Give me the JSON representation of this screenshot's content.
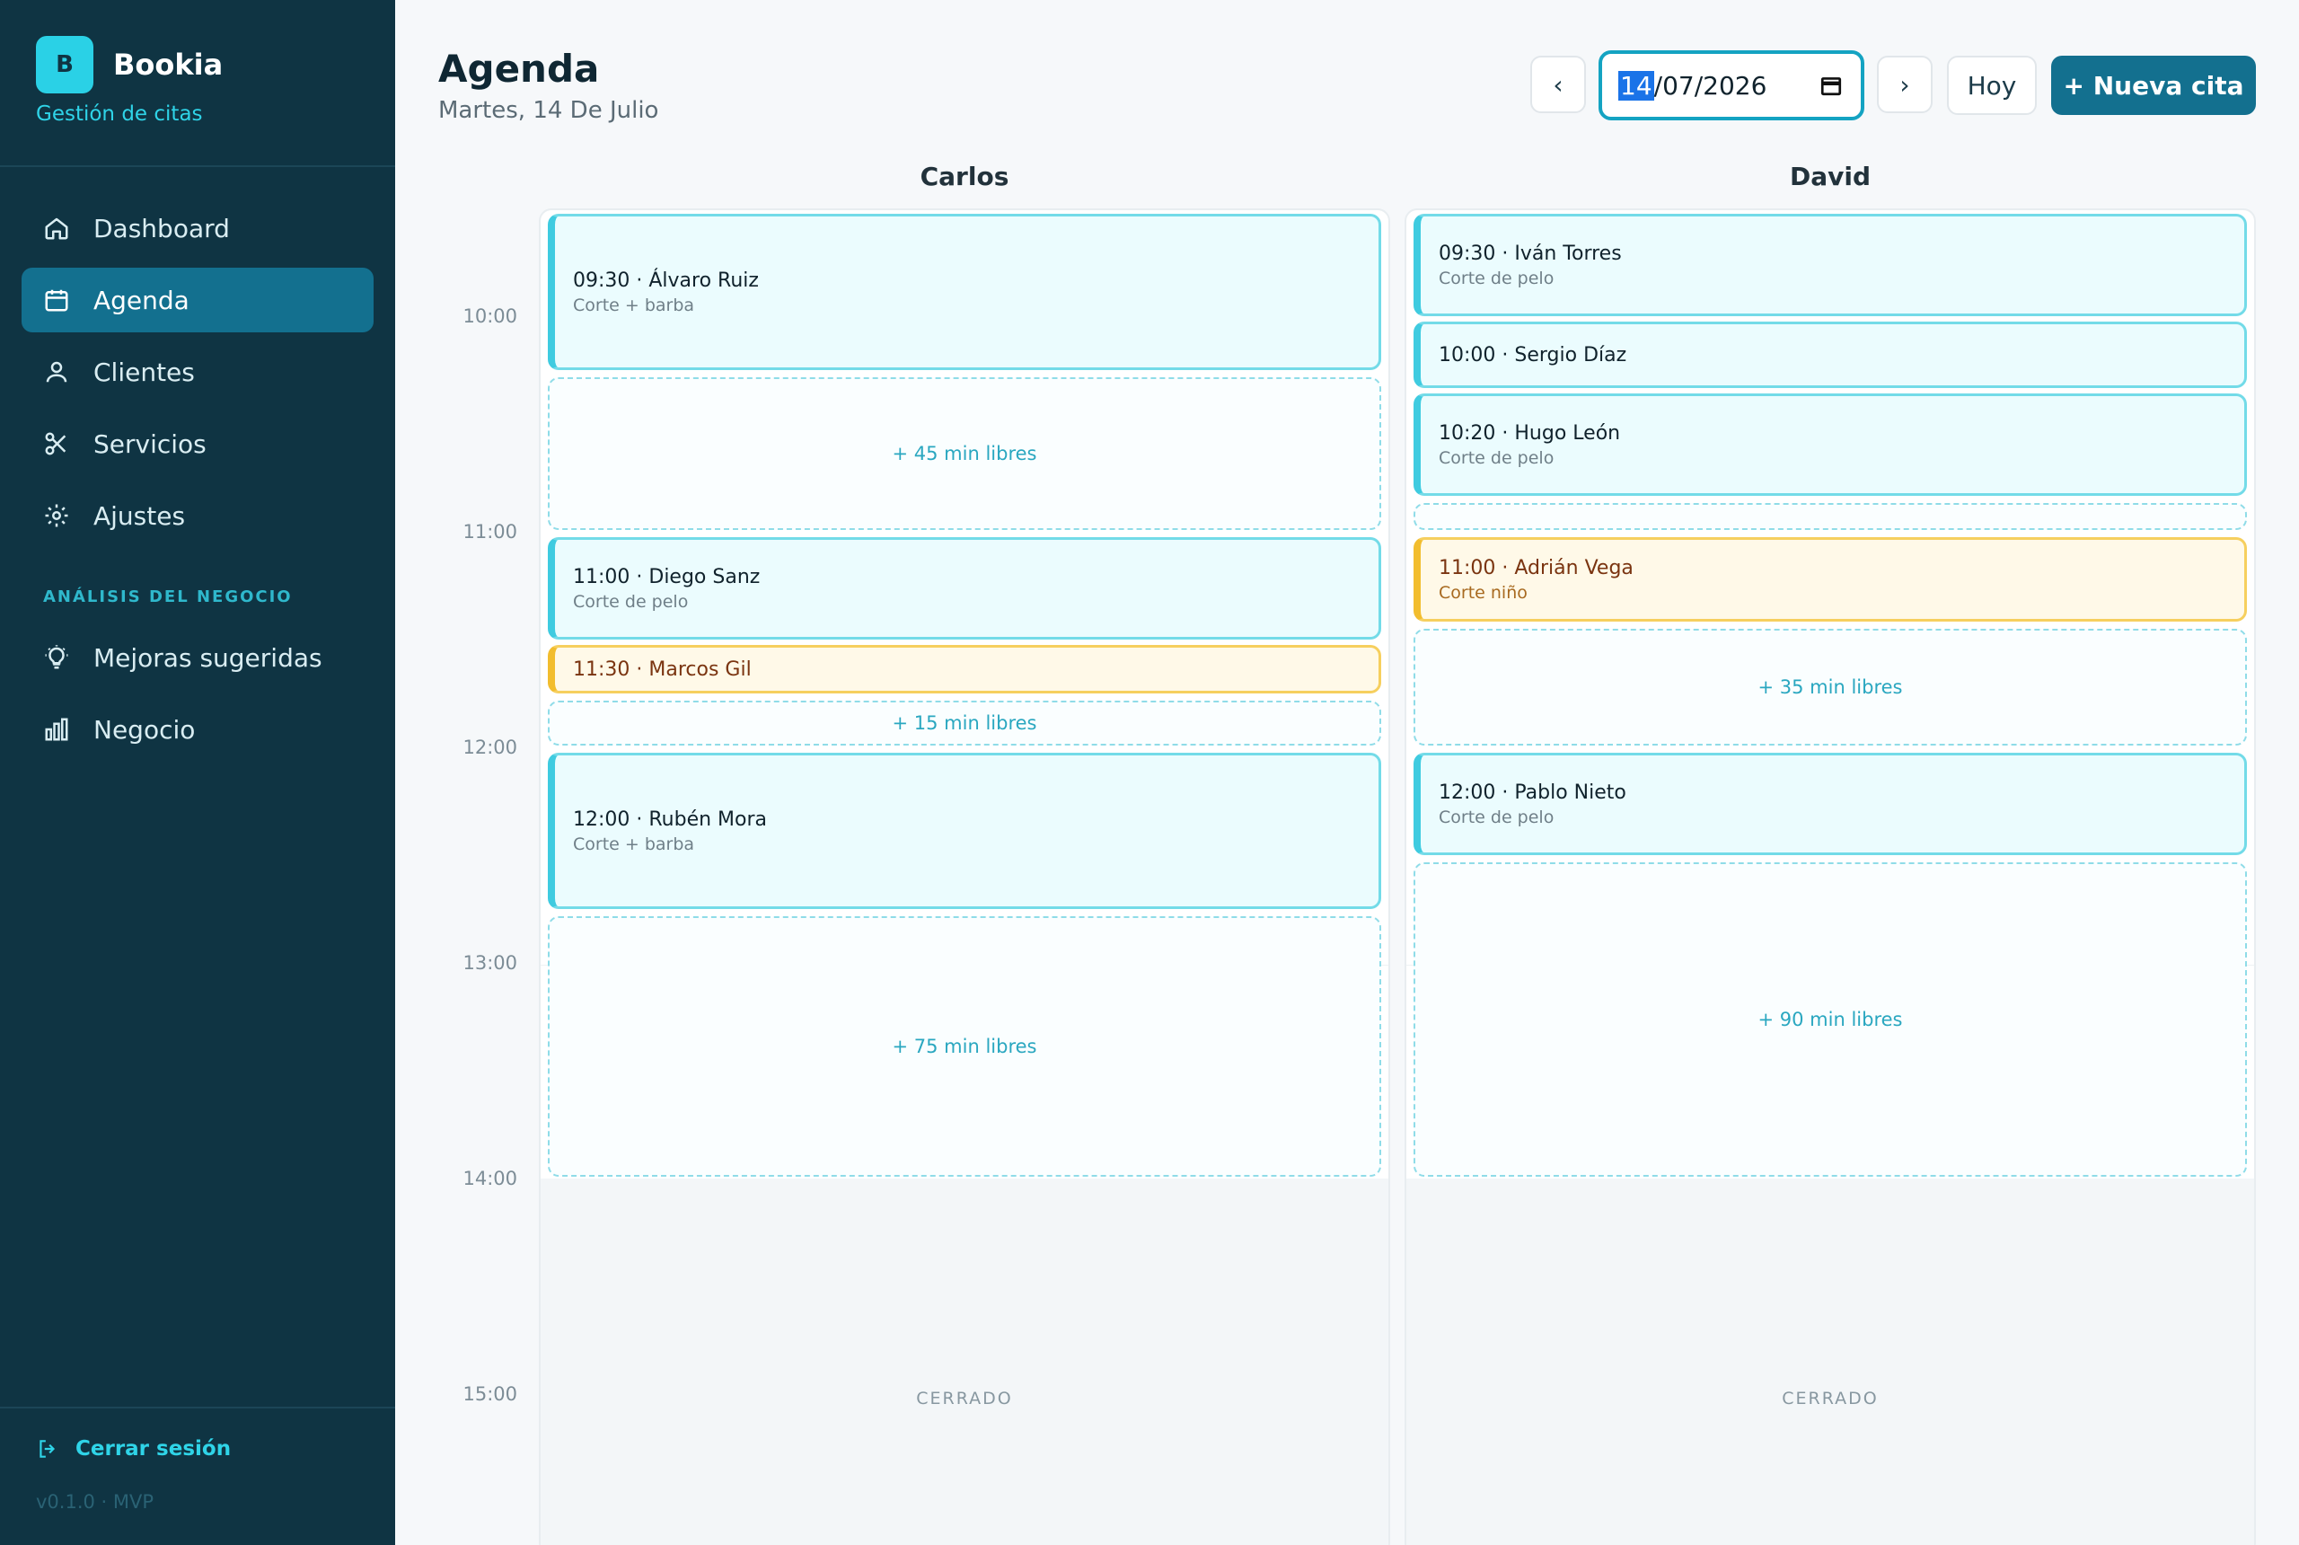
{
  "app": {
    "logo_letter": "B",
    "name": "Bookia",
    "subtitle": "Gestión de citas"
  },
  "sidebar": {
    "items": [
      {
        "label": "Dashboard",
        "icon": "home-icon",
        "active": false
      },
      {
        "label": "Agenda",
        "icon": "calendar-icon",
        "active": true
      },
      {
        "label": "Clientes",
        "icon": "users-icon",
        "active": false
      },
      {
        "label": "Servicios",
        "icon": "scissors-icon",
        "active": false
      },
      {
        "label": "Ajustes",
        "icon": "gear-icon",
        "active": false
      }
    ],
    "section_label": "ANÁLISIS DEL NEGOCIO",
    "section_items": [
      {
        "label": "Mejoras sugeridas",
        "icon": "lightbulb-icon"
      },
      {
        "label": "Negocio",
        "icon": "bar-chart-icon"
      }
    ],
    "logout_label": "Cerrar sesión",
    "version": "v0.1.0 · MVP"
  },
  "header": {
    "title": "Agenda",
    "subtitle": "Martes, 14 De Julio",
    "prev_label": "‹",
    "next_label": "›",
    "date": {
      "day": "14",
      "rest": "/07/2026"
    },
    "today_label": "Hoy",
    "new_label": "+ Nueva cita"
  },
  "time_labels": [
    "10:00",
    "11:00",
    "12:00",
    "13:00",
    "14:00",
    "15:00"
  ],
  "columns": [
    {
      "name": "Carlos",
      "closed_label": "CERRADO",
      "appointments": [
        {
          "title": "09:30 · Álvaro Ruiz",
          "service": "Corte + barba"
        },
        {
          "title": "11:00 · Diego Sanz",
          "service": "Corte de pelo"
        },
        {
          "title": "11:30 · Marcos Gil",
          "service": ""
        },
        {
          "title": "12:00 · Rubén Mora",
          "service": "Corte + barba"
        }
      ],
      "free": [
        "+ 45 min libres",
        "+ 15 min libres",
        "+ 75 min libres"
      ]
    },
    {
      "name": "David",
      "closed_label": "CERRADO",
      "appointments": [
        {
          "title": "09:30 · Iván Torres",
          "service": "Corte de pelo"
        },
        {
          "title": "10:00 · Sergio Díaz",
          "service": ""
        },
        {
          "title": "10:20 · Hugo León",
          "service": "Corte de pelo"
        },
        {
          "title": "11:00 · Adrián Vega",
          "service": "Corte niño"
        },
        {
          "title": "12:00 · Pablo Nieto",
          "service": "Corte de pelo"
        }
      ],
      "free": [
        "",
        "+ 35 min libres",
        "+ 90 min libres"
      ]
    }
  ],
  "colors": {
    "sidebar_bg": "#0f3443",
    "accent": "#13708f",
    "appointment_confirmed": "#3fcbe0",
    "appointment_pending": "#f2bd2e"
  }
}
